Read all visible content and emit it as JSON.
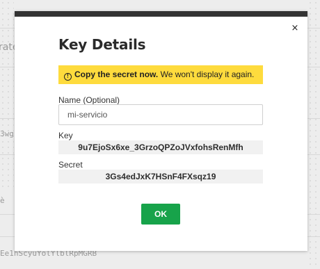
{
  "background": {
    "fragments": [
      "rate",
      "3wg",
      "è",
      "Ee1hScyuYolYlblRpMGRB"
    ]
  },
  "modal": {
    "title": "Key Details",
    "close_icon": "×",
    "alert": {
      "icon": "!",
      "strong": "Copy the secret now.",
      "text": " We won't display it again."
    },
    "name_label": "Name (Optional)",
    "name_value": "mi-servicio",
    "key_label": "Key",
    "key_value": "9u7EjoSx6xe_3GrzoQPZoJVxfohsRenMfh",
    "secret_label": "Secret",
    "secret_value": "3Gs4edJxK7HSnF4FXsqz19",
    "ok_label": "OK"
  },
  "colors": {
    "topbar": "#333333",
    "alert_bg": "#fedb3d",
    "ok_button": "#17a34a",
    "value_bg": "#f1f1f1"
  }
}
